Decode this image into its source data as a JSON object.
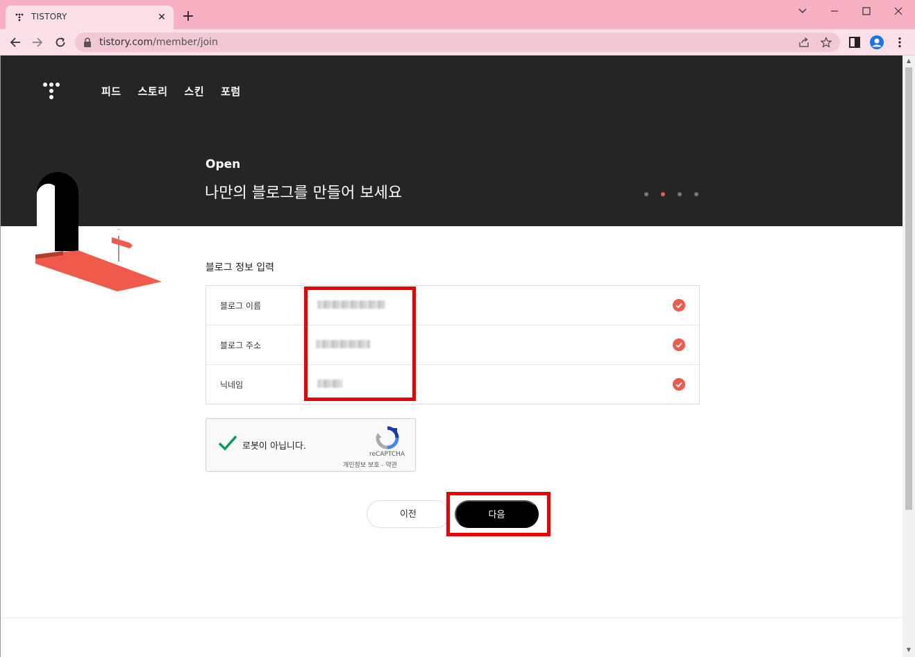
{
  "browser": {
    "tab_title": "TISTORY",
    "url_host": "tistory.com",
    "url_path": "/member/join"
  },
  "header": {
    "nav": [
      "피드",
      "스토리",
      "스킨",
      "포럼"
    ]
  },
  "hero": {
    "title": "Open",
    "subtitle": "나만의 블로그를 만들어 보세요",
    "step_count": 4,
    "active_step": 2
  },
  "form": {
    "section_title": "블로그 정보 입력",
    "rows": [
      {
        "label": "블로그 이름",
        "value_blurred": true,
        "status": "valid"
      },
      {
        "label": "블로그 주소",
        "value_blurred": true,
        "status": "valid"
      },
      {
        "label": "닉네임",
        "value_blurred": true,
        "status": "valid"
      }
    ]
  },
  "captcha": {
    "label": "로봇이 아닙니다.",
    "checked": true,
    "brand": "reCAPTCHA",
    "links": "개인정보 보호 - 약관"
  },
  "buttons": {
    "prev": "이전",
    "next": "다음"
  },
  "colors": {
    "accent": "#ef5a4a",
    "highlight": "#ee0000",
    "hero_bg": "#252525",
    "titlebar": "#f8b0c3"
  }
}
